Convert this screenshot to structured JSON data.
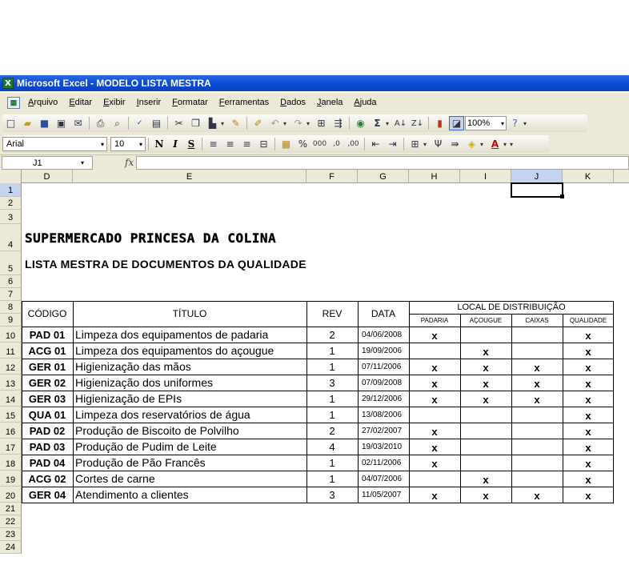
{
  "window": {
    "title": "Microsoft Excel - MODELO LISTA MESTRA"
  },
  "menu": [
    "Arquivo",
    "Editar",
    "Exibir",
    "Inserir",
    "Formatar",
    "Ferramentas",
    "Dados",
    "Janela",
    "Ajuda"
  ],
  "toolbar": {
    "zoom": "100%",
    "font": "Arial",
    "size": "10"
  },
  "formula_bar": {
    "cell_ref": "J1",
    "fx": "fx",
    "value": ""
  },
  "columns": [
    "D",
    "E",
    "F",
    "G",
    "H",
    "I",
    "J",
    "K"
  ],
  "rows": [
    "1",
    "2",
    "3",
    "4",
    "5",
    "6",
    "7",
    "8",
    "9",
    "10",
    "11",
    "12",
    "13",
    "14",
    "15",
    "16",
    "17",
    "18",
    "19",
    "20",
    "21",
    "22",
    "23",
    "24"
  ],
  "sheet": {
    "company": "SUPERMERCADO PRINCESA DA COLINA",
    "list_title": "LISTA MESTRA DE DOCUMENTOS DA QUALIDADE",
    "headers": {
      "code": "CÓDIGO",
      "title": "TÍTULO",
      "rev": "REV",
      "date": "DATA",
      "distribution": "LOCAL DE DISTRIBUIÇÃO",
      "locations": [
        "PADARIA",
        "AÇOUGUE",
        "CAIXAS",
        "QUALIDADE"
      ]
    },
    "documents": [
      {
        "code": "PAD 01",
        "title": "Limpeza dos equipamentos de padaria",
        "rev": "2",
        "date": "04/06/2008",
        "marks": [
          "x",
          "",
          "",
          "x"
        ]
      },
      {
        "code": "ACG 01",
        "title": "Limpeza dos equipamentos do açougue",
        "rev": "1",
        "date": "19/09/2006",
        "marks": [
          "",
          "x",
          "",
          "x"
        ]
      },
      {
        "code": "GER 01",
        "title": "Higienização das mãos",
        "rev": "1",
        "date": "07/11/2006",
        "marks": [
          "x",
          "x",
          "x",
          "x"
        ]
      },
      {
        "code": "GER 02",
        "title": "Higienização dos uniformes",
        "rev": "3",
        "date": "07/09/2008",
        "marks": [
          "x",
          "x",
          "x",
          "x"
        ]
      },
      {
        "code": "GER 03",
        "title": "Higienização de EPIs",
        "rev": "1",
        "date": "29/12/2006",
        "marks": [
          "x",
          "x",
          "x",
          "x"
        ]
      },
      {
        "code": "QUA 01",
        "title": "Limpeza dos reservatórios de água",
        "rev": "1",
        "date": "13/08/2006",
        "marks": [
          "",
          "",
          "",
          "x"
        ]
      },
      {
        "code": "PAD 02",
        "title": "Produção de Biscoito de Polvilho",
        "rev": "2",
        "date": "27/02/2007",
        "marks": [
          "x",
          "",
          "",
          "x"
        ]
      },
      {
        "code": "PAD 03",
        "title": "Produção de Pudim de Leite",
        "rev": "4",
        "date": "19/03/2010",
        "marks": [
          "x",
          "",
          "",
          "x"
        ]
      },
      {
        "code": "PAD 04",
        "title": "Produção de Pão Francês",
        "rev": "1",
        "date": "02/11/2006",
        "marks": [
          "x",
          "",
          "",
          "x"
        ]
      },
      {
        "code": "ACG 02",
        "title": "Cortes de carne",
        "rev": "1",
        "date": "04/07/2006",
        "marks": [
          "",
          "x",
          "",
          "x"
        ]
      },
      {
        "code": "GER 04",
        "title": "Atendimento a clientes",
        "rev": "3",
        "date": "11/05/2007",
        "marks": [
          "x",
          "x",
          "x",
          "x"
        ]
      }
    ]
  }
}
